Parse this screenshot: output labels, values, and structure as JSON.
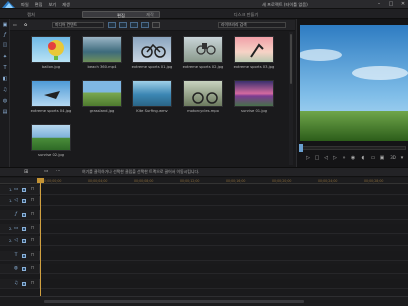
{
  "menu": [
    "파일",
    "편집",
    "보기",
    "재생"
  ],
  "window_title": "새 프로젝트 (타이틀 없음)",
  "modes": {
    "capture": "캡처",
    "edit": "편집",
    "produce": "제작",
    "disc": "디스크 만들기"
  },
  "library": {
    "tab_label": "미디어 라이브러리",
    "filter_select": "미디어 컨텐트",
    "search_placeholder": "라이브러리 검색",
    "items": [
      {
        "name": "ballon.jpg"
      },
      {
        "name": "beach 360.mp4"
      },
      {
        "name": "extreme sports 01.jpg"
      },
      {
        "name": "extreme sports 02.jpg"
      },
      {
        "name": "extreme sports 03.jpg"
      },
      {
        "name": "extreme sports 04.jpg"
      },
      {
        "name": "grassland.jpg"
      },
      {
        "name": "Kite Surfing.wmv"
      },
      {
        "name": "motorcycles.mpo"
      },
      {
        "name": "sunrise 01.jpg"
      },
      {
        "name": "sunrise 02.jpg"
      }
    ]
  },
  "timeline": {
    "hint": "여기를 클릭하거나 선택한 클립을 선택한 트랙으로 끌어서 이동시킵니다.",
    "ruler": [
      "00;00;00;00",
      "00;00;04;00",
      "00;00;08;00",
      "00;00;12;00",
      "00;00;16;00",
      "00;00;20;00",
      "00;00;24;00",
      "00;00;28;00",
      "00;00;32;00"
    ],
    "tracks": [
      {
        "icon": "video",
        "num": "1."
      },
      {
        "icon": "audio",
        "num": "1."
      },
      {
        "icon": "fx",
        "num": ""
      },
      {
        "icon": "video",
        "num": "2."
      },
      {
        "icon": "audio",
        "num": "2."
      },
      {
        "icon": "title",
        "num": ""
      },
      {
        "icon": "voice",
        "num": ""
      },
      {
        "icon": "music",
        "num": ""
      }
    ]
  },
  "preview": {
    "zoom": "3D"
  }
}
